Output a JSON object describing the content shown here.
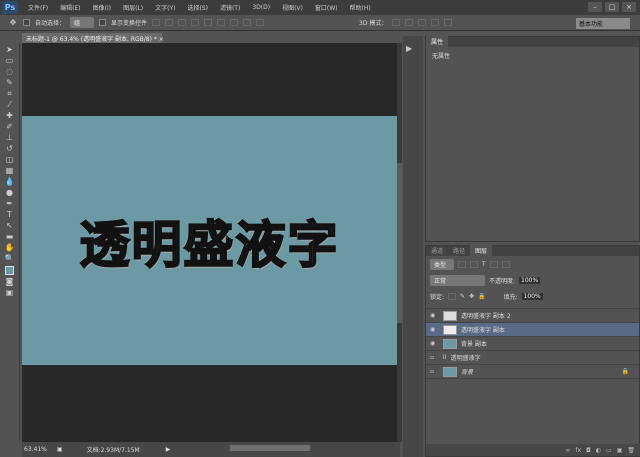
{
  "app": {
    "logo": "Ps"
  },
  "menu": [
    "文件(F)",
    "编辑(E)",
    "图像(I)",
    "图层(L)",
    "文字(Y)",
    "选择(S)",
    "滤镜(T)",
    "3D(D)",
    "视图(V)",
    "窗口(W)",
    "帮助(H)"
  ],
  "window_controls": [
    "–",
    "□",
    "×"
  ],
  "options": {
    "auto_select_label": "自动选择：",
    "auto_select_value": "组",
    "show_transform_label": "显示变换控件",
    "mode_3d_label": "3D 模式：",
    "workspace": "基本功能"
  },
  "document": {
    "tab": "未标题-1 @ 63.4% (透明盛液字 副本, RGB/8) *",
    "close": "×",
    "art_text": "透明盛液字",
    "canvas_color": "#6b9aa4"
  },
  "status": {
    "zoom": "63.41%",
    "doc_info": "文档:2.93M/7.15M",
    "arrow": "▶"
  },
  "properties": {
    "tab": "属性",
    "content": "无属性"
  },
  "layers": {
    "tabs": [
      "通道",
      "路径",
      "图层"
    ],
    "filter": "类型",
    "blend_mode": "正常",
    "opacity_label": "不透明度:",
    "opacity": "100%",
    "lock_label": "锁定:",
    "fill_label": "填充:",
    "fill": "100%",
    "items": [
      {
        "name": "透明盛液字 副本 2",
        "visible": true,
        "selected": false,
        "thumb": "#ddd"
      },
      {
        "name": "透明盛液字 副本",
        "visible": true,
        "selected": true,
        "thumb": "#eee"
      },
      {
        "name": "背景 副本",
        "visible": true,
        "selected": false,
        "thumb": "#6b9aa4"
      },
      {
        "name": "透明盛液字",
        "visible": false,
        "selected": false,
        "thumb": "group"
      },
      {
        "name": "背景",
        "visible": false,
        "selected": false,
        "thumb": "#6b9aa4",
        "locked": true
      }
    ],
    "footer_icons": [
      "link-icon",
      "fx-icon",
      "mask-icon",
      "adjustment-icon",
      "folder-icon",
      "new-layer-icon",
      "trash-icon"
    ],
    "footer_glyphs": [
      "∞",
      "fx",
      "◘",
      "◐",
      "▭",
      "▣",
      "🗑"
    ]
  }
}
